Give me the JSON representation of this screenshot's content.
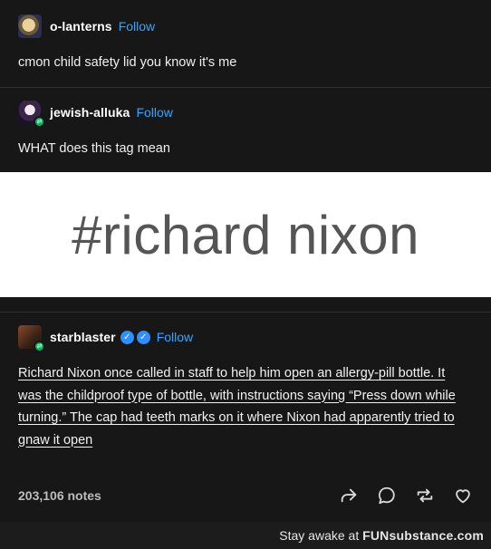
{
  "posts": [
    {
      "username": "o-lanterns",
      "follow": "Follow",
      "text": "cmon child safety lid you know it's me"
    },
    {
      "username": "jewish-alluka",
      "follow": "Follow",
      "text": "WHAT does this tag mean",
      "image_text": "#richard nixon"
    },
    {
      "username": "starblaster",
      "follow": "Follow",
      "text": "Richard Nixon once called in staff to help him open an allergy-pill bottle. It was the childproof type of bottle, with instructions saying “Press down while turning.” The cap had teeth marks on it where Nixon had apparently tried to gnaw it open"
    }
  ],
  "footer": {
    "notes": "203,106 notes"
  },
  "icons": {
    "share": "share-icon",
    "reply": "reply-icon",
    "reblog": "reblog-icon",
    "like": "heart-icon"
  },
  "watermark": {
    "prefix": "Stay awake at ",
    "brand": "FUNsubstance.com"
  },
  "colors": {
    "accent": "#32a6ff",
    "background": "#171717",
    "reblog_badge": "#00b85c"
  }
}
